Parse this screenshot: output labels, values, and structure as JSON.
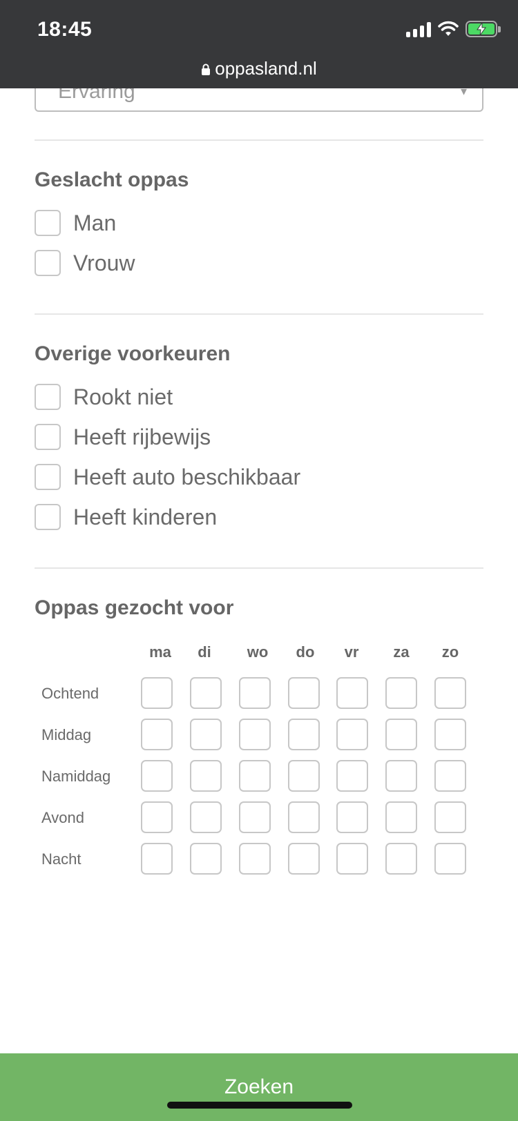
{
  "status_bar": {
    "time": "18:45",
    "url": "oppasland.nl",
    "icons": [
      "signal-icon",
      "wifi-icon",
      "battery-charging-icon",
      "lock-icon"
    ],
    "battery_color": "#4cd964"
  },
  "experience_select": {
    "value": "Ervaring"
  },
  "gender": {
    "title": "Geslacht oppas",
    "options": [
      "Man",
      "Vrouw"
    ]
  },
  "preferences": {
    "title": "Overige voorkeuren",
    "options": [
      "Rookt niet",
      "Heeft rijbewijs",
      "Heeft auto beschikbaar",
      "Heeft kinderen"
    ]
  },
  "schedule": {
    "title": "Oppas gezocht voor",
    "days": [
      "ma",
      "di",
      "wo",
      "do",
      "vr",
      "za",
      "zo"
    ],
    "times": [
      "Ochtend",
      "Middag",
      "Namiddag",
      "Avond",
      "Nacht"
    ]
  },
  "search_button": {
    "label": "Zoeken",
    "color": "#72b565"
  }
}
